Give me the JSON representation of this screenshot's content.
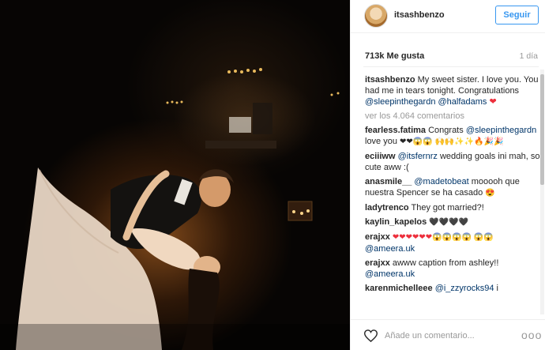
{
  "post": {
    "username": "itsashbenzo",
    "follow_label": "Seguir",
    "likes": "713k Me gusta",
    "time": "1 día",
    "view_all": "ver los 4.064 comentarios",
    "add_comment_placeholder": "Añade un comentario...",
    "more_label": "ooo"
  },
  "caption": {
    "user": "itsashbenzo",
    "text": "My sweet sister. I love you. You had me in tears tonight. Congratulations",
    "mention1": "@sleepinthegardn",
    "mention2": "@halfadams",
    "emoji": "❤"
  },
  "comments": [
    {
      "user": "fearless.fatima",
      "text": "Congrats",
      "mention": "@sleepinthegardn",
      "after": "love you",
      "emoji": "❤❤😱😱 🙌🙌✨✨🔥🎉🎉"
    },
    {
      "user": "eciiiww",
      "text": "",
      "mention": "@itsfernrz",
      "after": "wedding goals ini mah, so cute aww :(",
      "emoji": ""
    },
    {
      "user": "anasmile__",
      "text": "",
      "mention": "@madetobeat",
      "after": "mooooh que nuestra Spencer se ha casado",
      "emoji": "😍"
    },
    {
      "user": "ladytrenco",
      "text": "They got married?!",
      "mention": "",
      "after": "",
      "emoji": ""
    },
    {
      "user": "kaylin_kapelos",
      "text": "",
      "mention": "",
      "after": "",
      "emoji": "🖤🖤🖤🖤"
    },
    {
      "user": "erajxx",
      "text": "",
      "mention": "",
      "after": "",
      "emoji": "❤❤❤❤❤❤😱😱😱😱 😱😱",
      "mention_after": "@ameera.uk"
    },
    {
      "user": "erajxx",
      "text": "awww caption from ashley!!",
      "mention": "",
      "after": "",
      "emoji": "",
      "mention_after": "@ameera.uk"
    },
    {
      "user": "karenmichelleee",
      "text": "",
      "mention": "@i_zzyrocks94",
      "after": "i",
      "emoji": ""
    }
  ]
}
